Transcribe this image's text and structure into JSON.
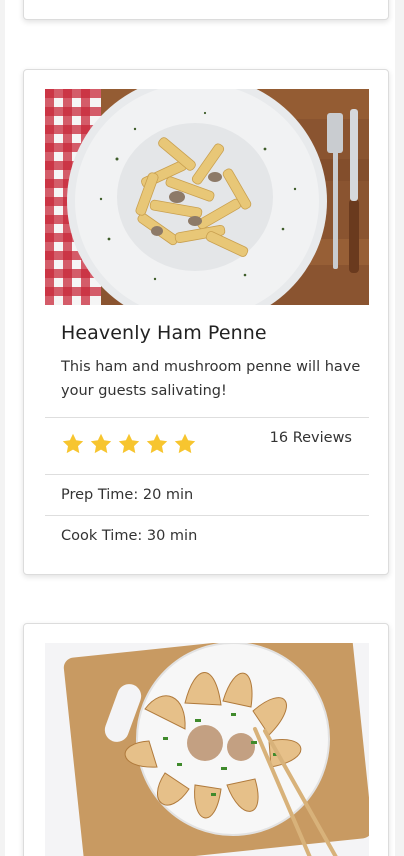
{
  "recipe": {
    "title": "Heavenly Ham Penne",
    "description": "This ham and mushroom penne will have your guests salivating!",
    "rating": 5,
    "rating_max": 5,
    "reviews_label": "16 Reviews",
    "prep_time": "Prep Time: 20 min",
    "cook_time": "Cook Time: 30 min"
  },
  "colors": {
    "star": "#f7c52f",
    "divider": "#dedede"
  },
  "icons": {
    "star": "star-icon"
  }
}
